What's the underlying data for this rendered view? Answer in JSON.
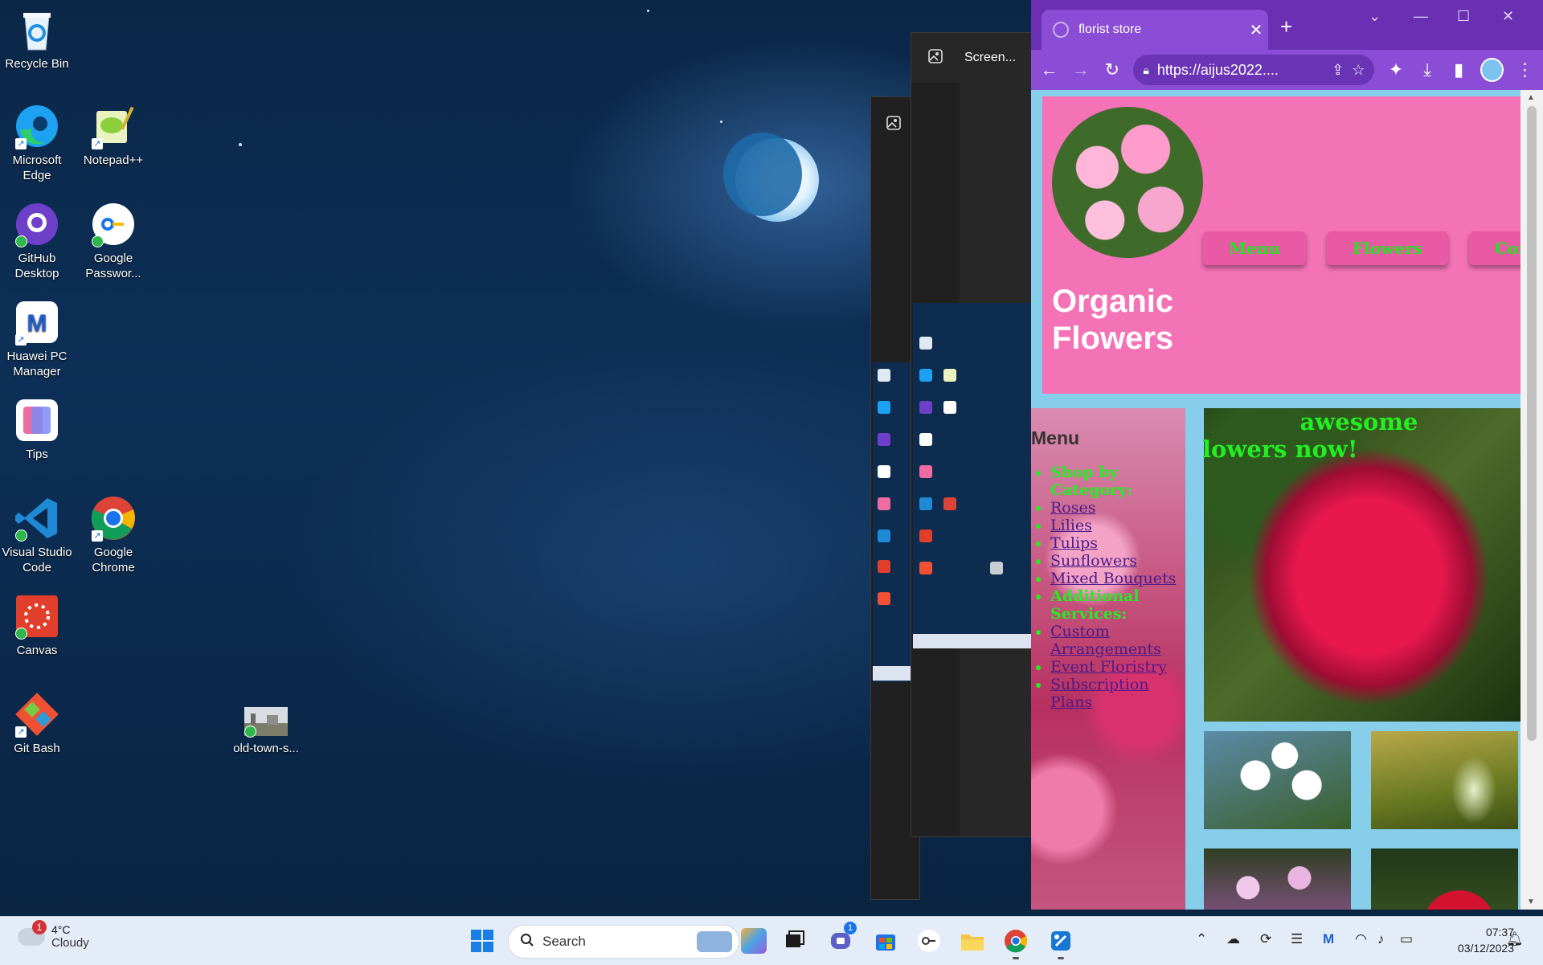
{
  "desktop": {
    "icons": [
      {
        "label": "Recycle Bin",
        "icon": "recycle-bin-icon"
      },
      {
        "label": "Microsoft Edge",
        "icon": "edge-icon"
      },
      {
        "label": "Notepad++",
        "icon": "notepadpp-icon"
      },
      {
        "label": "GitHub Desktop",
        "icon": "github-desktop-icon"
      },
      {
        "label": "Google Passwor...",
        "icon": "google-password-icon"
      },
      {
        "label": "Huawei PC Manager",
        "icon": "huawei-pc-manager-icon"
      },
      {
        "label": "Tips",
        "icon": "tips-icon"
      },
      {
        "label": "Visual Studio Code",
        "icon": "vscode-icon"
      },
      {
        "label": "Google Chrome",
        "icon": "chrome-icon"
      },
      {
        "label": "Canvas",
        "icon": "canvas-icon"
      },
      {
        "label": "Git Bash",
        "icon": "git-bash-icon"
      },
      {
        "label": "old-town-s...",
        "icon": "image-file-icon"
      }
    ]
  },
  "snip_tool": {
    "title": "Screen..."
  },
  "browser": {
    "tab_title": "florist store",
    "url": "https://aijus2022....",
    "colors": {
      "frame": "#6a2fb3",
      "tab": "#8b4dd6"
    }
  },
  "site": {
    "title_line1": "Organic",
    "title_line2": "Flowers",
    "nav": [
      "Menu",
      "Flowers",
      "Contact"
    ],
    "sidebar_heading": "Menu",
    "sidebar_items": [
      {
        "type": "category",
        "text": "Shop by Category:"
      },
      {
        "type": "link",
        "text": "Roses"
      },
      {
        "type": "link",
        "text": "Lilies"
      },
      {
        "type": "link",
        "text": "Tulips"
      },
      {
        "type": "link",
        "text": "Sunflowers"
      },
      {
        "type": "link",
        "text": "Mixed Bouquets"
      },
      {
        "type": "category",
        "text": "Additional Services:"
      },
      {
        "type": "link",
        "text": "Custom Arrangements"
      },
      {
        "type": "link",
        "text": "Event Floristry"
      },
      {
        "type": "link",
        "text": "Subscription Plans"
      }
    ],
    "hero_line1": "awesome",
    "hero_line2": "lowers now!",
    "colors": {
      "header": "#f472b6",
      "accent_text": "#22ee22",
      "page_bg": "#87ceeb"
    }
  },
  "taskbar": {
    "weather_temp": "4°C",
    "weather_desc": "Cloudy",
    "weather_badge": "1",
    "search_placeholder": "Search",
    "teams_badge": "1",
    "time": "07:37",
    "date": "03/12/2023"
  }
}
